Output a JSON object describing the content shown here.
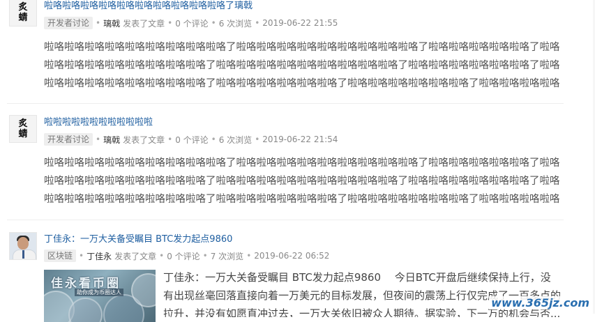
{
  "posts": [
    {
      "avatar_text": [
        "炙",
        "蜻"
      ],
      "title": "啦咯啦咯啦咯啦咯啦咯啦咯啦咯啦咯啦咯啦咯了璃戟",
      "tag": "开发者讨论",
      "author": "璃戟",
      "action": "发表了文章",
      "comments": "0 个评论",
      "views": "6 次浏览",
      "time": "2019-06-22 21:55",
      "excerpt": "啦咯啦咯啦咯啦咯啦咯啦咯啦咯啦咯啦咯了啦咯啦咯啦咯啦咯啦咯啦咯啦咯啦咯啦咯了啦咯啦咯啦咯啦咯啦咯了啦咯啦咯啦咯啦咯啦咯啦咯啦咯啦咯啦咯了啦咯啦咯啦咯啦咯啦咯啦咯啦咯啦咯啦咯了啦咯啦咯啦咯啦咯啦咯啦咯了啦咯啦咯啦咯啦咯啦咯啦咯啦咯啦咯啦咯了啦咯啦咯啦咯啦咯啦咯啦咯了啦咯啦咯啦咯啦咯啦咯啦咯了啦咯啦咯啦咯啦咯啦咯啦咯啦咯了啦咯啦咯啦咯啦咯啦咯啦咯啦咯啦咯啦咯了啦咯啦咯啦咯啦咯啦咯啦咯啦..."
    },
    {
      "avatar_text": [
        "炙",
        "蜻"
      ],
      "title": "啦啦啦啦啦啦啦啦啦啦啦啦",
      "tag": "开发者讨论",
      "author": "璃戟",
      "action": "发表了文章",
      "comments": "0 个评论",
      "views": "6 次浏览",
      "time": "2019-06-22 21:54",
      "excerpt": "啦咯啦咯啦咯啦咯啦咯啦咯啦咯啦咯啦咯了啦咯啦咯啦咯啦咯啦咯啦咯啦咯啦咯啦咯了啦咯啦咯啦咯啦咯啦咯了啦咯啦咯啦咯啦咯啦咯啦咯啦咯啦咯啦咯了啦咯啦咯啦咯啦咯啦咯啦咯啦咯啦咯啦咯了啦咯啦咯啦咯啦咯啦咯啦咯了啦咯啦咯啦咯啦咯啦咯啦咯啦咯啦咯啦咯了啦咯啦咯啦咯啦咯啦咯啦咯了啦咯啦咯啦咯啦咯啦咯啦咯了啦咯啦咯啦咯啦咯啦咯啦咯啦咯了啦咯啦咯啦咯啦咯啦咯啦咯啦咯啦咯啦咯了啦咯啦咯啦咯啦咯啦咯啦咯啦..."
    },
    {
      "title": "丁佳永：一万大关备受瞩目 BTC发力起点9860",
      "tag": "区块链",
      "author": "丁佳永",
      "action": "发表了文章",
      "comments": "0 个评论",
      "views": "7 次浏览",
      "time": "2019-06-22 06:52",
      "thumb_title": "佳永看币圈",
      "thumb_sub": "助你成为币圈达人",
      "excerpt": "丁佳永：一万大关备受瞩目 BTC发力起点9860　 今日BTC开盘后继续保持上行，没有出现丝毫回落直接向着一万美元的目标发展，但夜间的震荡上行仅完成了一百多点的拉升，并没有如愿直冲过去，一万大关依旧被众人期待。据实验，下一万的机会与否..."
    }
  ],
  "watermark": "www.365jz.com"
}
